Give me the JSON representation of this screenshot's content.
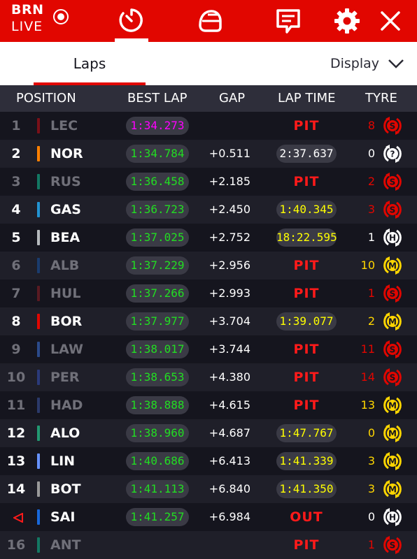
{
  "header": {
    "brand_line1": "BRN",
    "brand_line2": "LIVE",
    "icons": [
      "live-dot-icon",
      "timer-icon",
      "helmet-icon",
      "chat-icon",
      "gear-icon",
      "close-icon"
    ]
  },
  "subbar": {
    "tab_label": "Laps",
    "display_label": "Display"
  },
  "columns": {
    "position": "POSITION",
    "best_lap": "BEST LAP",
    "gap": "GAP",
    "lap_time": "LAP TIME",
    "tyre": "TYRE"
  },
  "colors": {
    "accent": "#e10600",
    "purple": "#ff00ff",
    "green": "#22dd22",
    "yellow": "#ffff00",
    "pit": "#ff1a1a",
    "soft": "#e10600",
    "medium": "#ffd600",
    "hard": "#ffffff",
    "dim_text": "#707079"
  },
  "rows": [
    {
      "pos": "1",
      "code": "LEC",
      "team": "#7a1018",
      "best": "1:34.273",
      "best_color": "#ff00ff",
      "gap": "",
      "lap": "PIT",
      "lap_kind": "pit",
      "tyre_laps": "8",
      "tyre": "S",
      "dim": true
    },
    {
      "pos": "2",
      "code": "NOR",
      "team": "#ff8000",
      "best": "1:34.784",
      "best_color": "#22dd22",
      "gap": "+0.511",
      "lap": "2:37.637",
      "lap_kind": "white",
      "tyre_laps": "0",
      "tyre": "?",
      "dim": false
    },
    {
      "pos": "3",
      "code": "RUS",
      "team": "#137863",
      "best": "1:36.458",
      "best_color": "#22dd22",
      "gap": "+2.185",
      "lap": "PIT",
      "lap_kind": "pit",
      "tyre_laps": "2",
      "tyre": "S",
      "dim": true
    },
    {
      "pos": "4",
      "code": "GAS",
      "team": "#2293d1",
      "best": "1:36.723",
      "best_color": "#22dd22",
      "gap": "+2.450",
      "lap": "1:40.345",
      "lap_kind": "yellow",
      "tyre_laps": "3",
      "tyre": "S",
      "dim": false
    },
    {
      "pos": "5",
      "code": "BEA",
      "team": "#b6babd",
      "best": "1:37.025",
      "best_color": "#22dd22",
      "gap": "+2.752",
      "lap": "18:22.595",
      "lap_kind": "yellow",
      "tyre_laps": "1",
      "tyre": "H",
      "dim": false
    },
    {
      "pos": "6",
      "code": "ALB",
      "team": "#1a3c6e",
      "best": "1:37.229",
      "best_color": "#22dd22",
      "gap": "+2.956",
      "lap": "PIT",
      "lap_kind": "pit",
      "tyre_laps": "10",
      "tyre": "M",
      "dim": true
    },
    {
      "pos": "7",
      "code": "HUL",
      "team": "#5a1a22",
      "best": "1:37.266",
      "best_color": "#22dd22",
      "gap": "+2.993",
      "lap": "PIT",
      "lap_kind": "pit",
      "tyre_laps": "1",
      "tyre": "S",
      "dim": true
    },
    {
      "pos": "8",
      "code": "BOR",
      "team": "#e10600",
      "best": "1:37.977",
      "best_color": "#22dd22",
      "gap": "+3.704",
      "lap": "1:39.077",
      "lap_kind": "yellow",
      "tyre_laps": "2",
      "tyre": "M",
      "dim": false
    },
    {
      "pos": "9",
      "code": "LAW",
      "team": "#2b4a8a",
      "best": "1:38.017",
      "best_color": "#22dd22",
      "gap": "+3.744",
      "lap": "PIT",
      "lap_kind": "pit",
      "tyre_laps": "11",
      "tyre": "S",
      "dim": true
    },
    {
      "pos": "10",
      "code": "PER",
      "team": "#2b3a7a",
      "best": "1:38.653",
      "best_color": "#22dd22",
      "gap": "+4.380",
      "lap": "PIT",
      "lap_kind": "pit",
      "tyre_laps": "14",
      "tyre": "S",
      "dim": true
    },
    {
      "pos": "11",
      "code": "HAD",
      "team": "#2b3a6a",
      "best": "1:38.888",
      "best_color": "#22dd22",
      "gap": "+4.615",
      "lap": "PIT",
      "lap_kind": "pit",
      "tyre_laps": "13",
      "tyre": "M",
      "dim": true
    },
    {
      "pos": "12",
      "code": "ALO",
      "team": "#229971",
      "best": "1:38.960",
      "best_color": "#22dd22",
      "gap": "+4.687",
      "lap": "1:47.767",
      "lap_kind": "yellow",
      "tyre_laps": "0",
      "tyre": "M",
      "dim": false
    },
    {
      "pos": "13",
      "code": "LIN",
      "team": "#6692ff",
      "best": "1:40.686",
      "best_color": "#22dd22",
      "gap": "+6.413",
      "lap": "1:41.339",
      "lap_kind": "yellow",
      "tyre_laps": "3",
      "tyre": "M",
      "dim": false
    },
    {
      "pos": "14",
      "code": "BOT",
      "team": "#9a9a9a",
      "best": "1:41.113",
      "best_color": "#22dd22",
      "gap": "+6.840",
      "lap": "1:41.350",
      "lap_kind": "yellow",
      "tyre_laps": "3",
      "tyre": "M",
      "dim": false
    },
    {
      "pos": "",
      "code": "SAI",
      "team": "#1868db",
      "best": "1:41.257",
      "best_color": "#22dd22",
      "gap": "+6.984",
      "lap": "OUT",
      "lap_kind": "pit",
      "tyre_laps": "0",
      "tyre": "H",
      "dim": false,
      "arrow": true
    },
    {
      "pos": "16",
      "code": "ANT",
      "team": "#137863",
      "best": "",
      "best_color": "#22dd22",
      "gap": "",
      "lap": "PIT",
      "lap_kind": "pit",
      "tyre_laps": "1",
      "tyre": "S",
      "dim": true
    }
  ]
}
